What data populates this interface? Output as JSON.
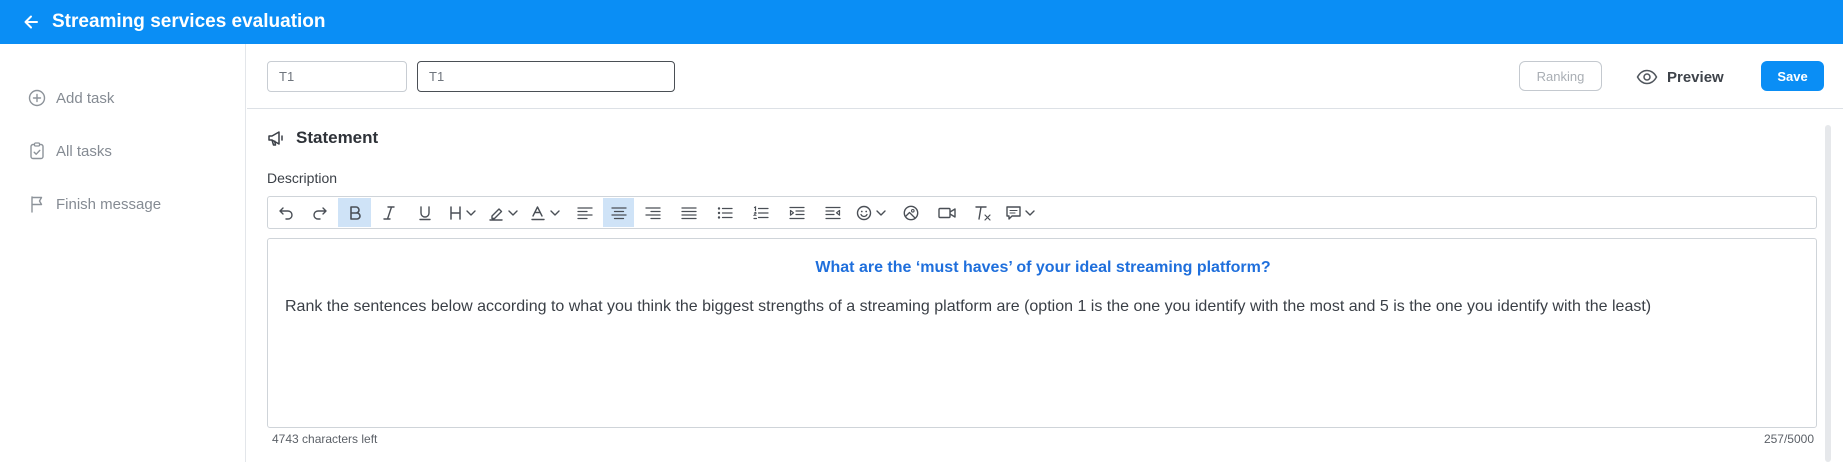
{
  "header": {
    "title": "Streaming services evaluation",
    "back_icon": "arrow-left-icon"
  },
  "sidebar": {
    "items": [
      {
        "label": "Add task",
        "icon": "plus-circle-icon"
      },
      {
        "label": "All tasks",
        "icon": "clipboard-check-icon"
      },
      {
        "label": "Finish message",
        "icon": "flag-icon"
      }
    ]
  },
  "task": {
    "id_value": "T1",
    "name_value": "T1",
    "type_label": "Ranking",
    "preview_label": "Preview",
    "save_label": "Save"
  },
  "statement": {
    "title": "Statement",
    "description_label": "Description",
    "heading": "What are the ‘must haves’ of your ideal streaming platform?",
    "body": "Rank the sentences below according to what you think the biggest strengths of a streaming platform are (option 1 is the one you identify with the most and 5 is the one you identify with the least)",
    "chars_left": "4743 characters left",
    "counter": "257/5000"
  },
  "toolbar": {
    "buttons": [
      "undo-icon",
      "redo-icon",
      "bold-icon",
      "italic-icon",
      "underline-icon",
      "heading-icon",
      "highlight-icon",
      "font-color-icon",
      "align-left-icon",
      "align-center-icon",
      "align-right-icon",
      "align-justify-icon",
      "bullet-list-icon",
      "numbered-list-icon",
      "indent-icon",
      "outdent-icon",
      "emoji-icon",
      "image-icon",
      "video-icon",
      "clear-format-icon",
      "comment-icon"
    ],
    "active": [
      "bold-icon",
      "align-center-icon"
    ]
  },
  "colors": {
    "brand": "#0a8ef5",
    "heading_text": "#1f6fdc",
    "active_tool": "#cfe3f7"
  }
}
